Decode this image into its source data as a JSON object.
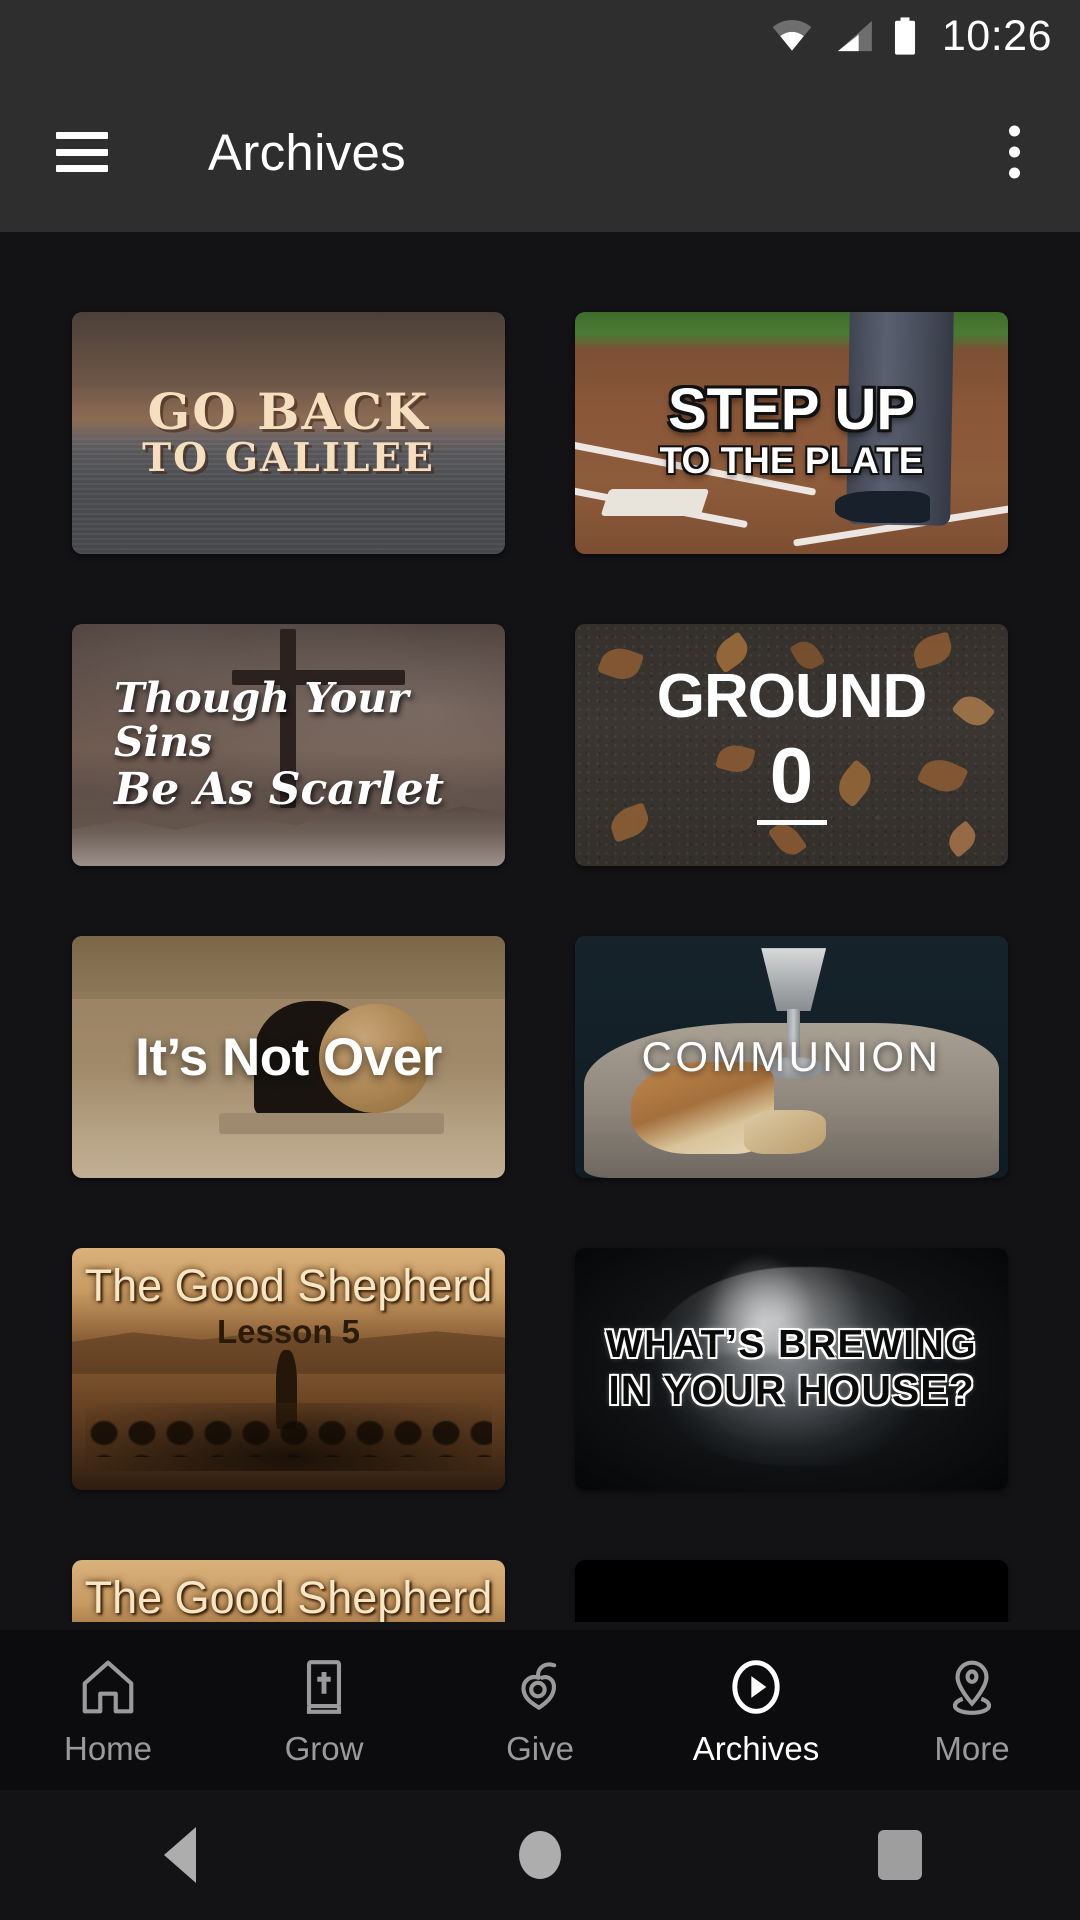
{
  "status_bar": {
    "time": "10:26",
    "icons": [
      "wifi-icon",
      "cellular-signal-icon",
      "battery-icon"
    ]
  },
  "app_bar": {
    "menu_icon": "hamburger-menu-icon",
    "title": "Archives",
    "overflow_icon": "more-vertical-icon"
  },
  "cards": [
    {
      "id": "go-back-to-galilee",
      "line1": "GO BACK",
      "line2": "TO GALILEE",
      "art": "sunset over the Sea of Galilee"
    },
    {
      "id": "step-up-to-the-plate",
      "line1": "STEP UP",
      "line2": "TO THE PLATE",
      "art": "baseball home plate with umpire legs"
    },
    {
      "id": "though-your-sins-be-as-scarlet",
      "line1": "Though Your Sins",
      "line2": "Be As Scarlet",
      "art": "cross silhouette against stormy clouds"
    },
    {
      "id": "ground-0",
      "line1": "GROUND",
      "line2": "0",
      "art": "dark soil scattered with dry brown leaves"
    },
    {
      "id": "its-not-over",
      "line1": "It’s Not Over",
      "line2": "",
      "art": "empty tomb with rolled-away stone"
    },
    {
      "id": "communion",
      "line1": "COMMUNION",
      "line2": "",
      "art": "bread loaf and silver chalice on linen"
    },
    {
      "id": "the-good-shepherd-lesson-5",
      "line1": "The Good Shepherd",
      "line2": "Lesson 5",
      "art": "shepherd leading a flock at dusk, sepia"
    },
    {
      "id": "whats-brewing-in-your-house",
      "line1": "WHAT’S BREWING",
      "line2": "IN YOUR HOUSE?",
      "art": "wispy white brain on black"
    },
    {
      "id": "the-good-shepherd-2",
      "line1": "The Good Shepherd",
      "line2": "",
      "art": "shepherd series title, partially scrolled"
    },
    {
      "id": "grayscale-gradient",
      "line1": "",
      "line2": "",
      "art": "white-to-black grayscale gradient bar"
    }
  ],
  "bottom_nav": {
    "items": [
      {
        "label": "Home",
        "icon": "home-icon",
        "active": false
      },
      {
        "label": "Grow",
        "icon": "bible-icon",
        "active": false
      },
      {
        "label": "Give",
        "icon": "giving-hands-icon",
        "active": false
      },
      {
        "label": "Archives",
        "icon": "play-circle-icon",
        "active": true
      },
      {
        "label": "More",
        "icon": "location-pin-icon",
        "active": false
      }
    ]
  },
  "android_nav": {
    "back": "back-triangle-icon",
    "home": "home-circle-icon",
    "recents": "recents-square-icon"
  },
  "colors": {
    "status_bar_bg": "#2E2E2E",
    "app_bar_bg": "#2E2E2E",
    "content_bg": "#131316",
    "bottom_nav_bg": "#0C0C0E",
    "active_nav": "#FFFFFF",
    "inactive_nav": "#9A9A9A"
  }
}
